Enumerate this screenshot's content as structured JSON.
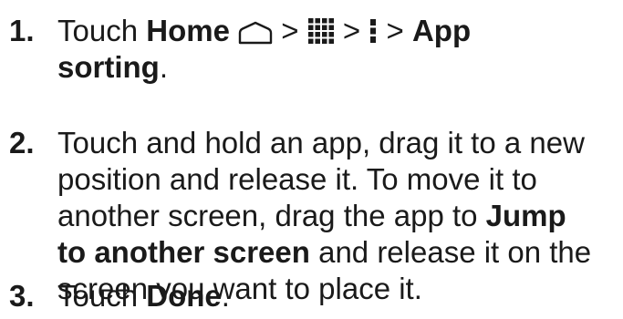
{
  "steps": [
    {
      "number": "1.",
      "line1": {
        "text_a": "Touch ",
        "bold_a": "Home",
        "sep_1": ">",
        "sep_2": ">",
        "sep_3": ">",
        "bold_b": "App"
      },
      "line2": {
        "bold": "sorting",
        "tail": "."
      },
      "icons": [
        "home-icon",
        "apps-grid-icon",
        "menu-dots-icon"
      ]
    },
    {
      "number": "2.",
      "line1": "Touch and hold an app, drag it to a new",
      "line2": "position and release it. To move it to",
      "line3": {
        "text": "another screen, drag the app to ",
        "bold": "Jump"
      },
      "line4": {
        "bold": "to another screen",
        "text": " and release it on the"
      },
      "line5": "screen you want to place it."
    },
    {
      "number": "3.",
      "text_a": "Touch ",
      "bold": "Done",
      "tail": "."
    }
  ]
}
